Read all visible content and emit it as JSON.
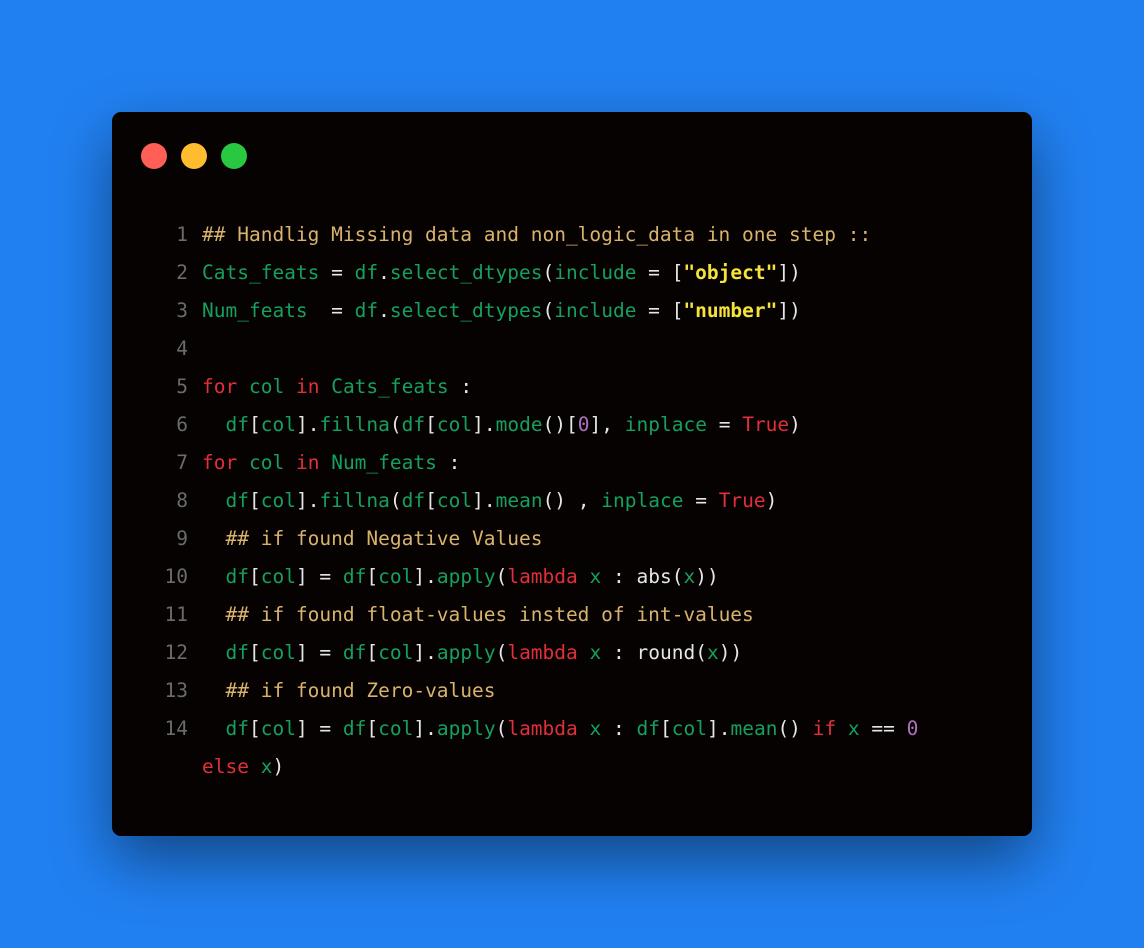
{
  "window": {
    "controls": [
      {
        "name": "close",
        "color": "#ff5f57"
      },
      {
        "name": "minimize",
        "color": "#febc2e"
      },
      {
        "name": "maximize",
        "color": "#28c840"
      }
    ]
  },
  "code": {
    "lines": [
      {
        "num": "1",
        "tokens": [
          {
            "t": "com",
            "v": "## Handlig Missing data and non_logic_data in one step ::"
          }
        ]
      },
      {
        "num": "2",
        "tokens": [
          {
            "t": "var",
            "v": "Cats_feats"
          },
          {
            "t": "pun",
            "v": " = "
          },
          {
            "t": "var",
            "v": "df"
          },
          {
            "t": "pun",
            "v": "."
          },
          {
            "t": "var",
            "v": "select_dtypes"
          },
          {
            "t": "pun",
            "v": "("
          },
          {
            "t": "var",
            "v": "include"
          },
          {
            "t": "pun",
            "v": " = ["
          },
          {
            "t": "str",
            "v": "\"object\""
          },
          {
            "t": "pun",
            "v": "])"
          }
        ]
      },
      {
        "num": "3",
        "tokens": [
          {
            "t": "var",
            "v": "Num_feats"
          },
          {
            "t": "pun",
            "v": "  = "
          },
          {
            "t": "var",
            "v": "df"
          },
          {
            "t": "pun",
            "v": "."
          },
          {
            "t": "var",
            "v": "select_dtypes"
          },
          {
            "t": "pun",
            "v": "("
          },
          {
            "t": "var",
            "v": "include"
          },
          {
            "t": "pun",
            "v": " = ["
          },
          {
            "t": "str",
            "v": "\"number\""
          },
          {
            "t": "pun",
            "v": "])"
          }
        ]
      },
      {
        "num": "4",
        "tokens": []
      },
      {
        "num": "5",
        "tokens": [
          {
            "t": "kw",
            "v": "for"
          },
          {
            "t": "pun",
            "v": " "
          },
          {
            "t": "var",
            "v": "col"
          },
          {
            "t": "pun",
            "v": " "
          },
          {
            "t": "kw",
            "v": "in"
          },
          {
            "t": "pun",
            "v": " "
          },
          {
            "t": "var",
            "v": "Cats_feats"
          },
          {
            "t": "pun",
            "v": " :"
          }
        ]
      },
      {
        "num": "6",
        "tokens": [
          {
            "t": "pun",
            "v": "  "
          },
          {
            "t": "var",
            "v": "df"
          },
          {
            "t": "pun",
            "v": "["
          },
          {
            "t": "var",
            "v": "col"
          },
          {
            "t": "pun",
            "v": "]."
          },
          {
            "t": "var",
            "v": "fillna"
          },
          {
            "t": "pun",
            "v": "("
          },
          {
            "t": "var",
            "v": "df"
          },
          {
            "t": "pun",
            "v": "["
          },
          {
            "t": "var",
            "v": "col"
          },
          {
            "t": "pun",
            "v": "]."
          },
          {
            "t": "var",
            "v": "mode"
          },
          {
            "t": "pun",
            "v": "()["
          },
          {
            "t": "num",
            "v": "0"
          },
          {
            "t": "pun",
            "v": "], "
          },
          {
            "t": "var",
            "v": "inplace"
          },
          {
            "t": "pun",
            "v": " = "
          },
          {
            "t": "kw",
            "v": "True"
          },
          {
            "t": "pun",
            "v": ")"
          }
        ]
      },
      {
        "num": "7",
        "tokens": [
          {
            "t": "kw",
            "v": "for"
          },
          {
            "t": "pun",
            "v": " "
          },
          {
            "t": "var",
            "v": "col"
          },
          {
            "t": "pun",
            "v": " "
          },
          {
            "t": "kw",
            "v": "in"
          },
          {
            "t": "pun",
            "v": " "
          },
          {
            "t": "var",
            "v": "Num_feats"
          },
          {
            "t": "pun",
            "v": " :"
          }
        ]
      },
      {
        "num": "8",
        "tokens": [
          {
            "t": "pun",
            "v": "  "
          },
          {
            "t": "var",
            "v": "df"
          },
          {
            "t": "pun",
            "v": "["
          },
          {
            "t": "var",
            "v": "col"
          },
          {
            "t": "pun",
            "v": "]."
          },
          {
            "t": "var",
            "v": "fillna"
          },
          {
            "t": "pun",
            "v": "("
          },
          {
            "t": "var",
            "v": "df"
          },
          {
            "t": "pun",
            "v": "["
          },
          {
            "t": "var",
            "v": "col"
          },
          {
            "t": "pun",
            "v": "]."
          },
          {
            "t": "var",
            "v": "mean"
          },
          {
            "t": "pun",
            "v": "() , "
          },
          {
            "t": "var",
            "v": "inplace"
          },
          {
            "t": "pun",
            "v": " = "
          },
          {
            "t": "kw",
            "v": "True"
          },
          {
            "t": "pun",
            "v": ")"
          }
        ]
      },
      {
        "num": "9",
        "tokens": [
          {
            "t": "com",
            "v": "  ## if found Negative Values"
          }
        ]
      },
      {
        "num": "10",
        "tokens": [
          {
            "t": "pun",
            "v": "  "
          },
          {
            "t": "var",
            "v": "df"
          },
          {
            "t": "pun",
            "v": "["
          },
          {
            "t": "var",
            "v": "col"
          },
          {
            "t": "pun",
            "v": "] = "
          },
          {
            "t": "var",
            "v": "df"
          },
          {
            "t": "pun",
            "v": "["
          },
          {
            "t": "var",
            "v": "col"
          },
          {
            "t": "pun",
            "v": "]."
          },
          {
            "t": "var",
            "v": "apply"
          },
          {
            "t": "pun",
            "v": "("
          },
          {
            "t": "kw",
            "v": "lambda"
          },
          {
            "t": "pun",
            "v": " "
          },
          {
            "t": "var",
            "v": "x"
          },
          {
            "t": "pun",
            "v": " : "
          },
          {
            "t": "fn",
            "v": "abs"
          },
          {
            "t": "pun",
            "v": "("
          },
          {
            "t": "var",
            "v": "x"
          },
          {
            "t": "pun",
            "v": "))"
          }
        ]
      },
      {
        "num": "11",
        "tokens": [
          {
            "t": "com",
            "v": "  ## if found float-values insted of int-values"
          }
        ]
      },
      {
        "num": "12",
        "tokens": [
          {
            "t": "pun",
            "v": "  "
          },
          {
            "t": "var",
            "v": "df"
          },
          {
            "t": "pun",
            "v": "["
          },
          {
            "t": "var",
            "v": "col"
          },
          {
            "t": "pun",
            "v": "] = "
          },
          {
            "t": "var",
            "v": "df"
          },
          {
            "t": "pun",
            "v": "["
          },
          {
            "t": "var",
            "v": "col"
          },
          {
            "t": "pun",
            "v": "]."
          },
          {
            "t": "var",
            "v": "apply"
          },
          {
            "t": "pun",
            "v": "("
          },
          {
            "t": "kw",
            "v": "lambda"
          },
          {
            "t": "pun",
            "v": " "
          },
          {
            "t": "var",
            "v": "x"
          },
          {
            "t": "pun",
            "v": " : "
          },
          {
            "t": "fn",
            "v": "round"
          },
          {
            "t": "pun",
            "v": "("
          },
          {
            "t": "var",
            "v": "x"
          },
          {
            "t": "pun",
            "v": "))"
          }
        ]
      },
      {
        "num": "13",
        "tokens": [
          {
            "t": "com",
            "v": "  ## if found Zero-values"
          }
        ]
      },
      {
        "num": "14",
        "wrap": true,
        "tokens": [
          {
            "t": "pun",
            "v": "  "
          },
          {
            "t": "var",
            "v": "df"
          },
          {
            "t": "pun",
            "v": "["
          },
          {
            "t": "var",
            "v": "col"
          },
          {
            "t": "pun",
            "v": "] = "
          },
          {
            "t": "var",
            "v": "df"
          },
          {
            "t": "pun",
            "v": "["
          },
          {
            "t": "var",
            "v": "col"
          },
          {
            "t": "pun",
            "v": "]."
          },
          {
            "t": "var",
            "v": "apply"
          },
          {
            "t": "pun",
            "v": "("
          },
          {
            "t": "kw",
            "v": "lambda"
          },
          {
            "t": "pun",
            "v": " "
          },
          {
            "t": "var",
            "v": "x"
          },
          {
            "t": "pun",
            "v": " : "
          },
          {
            "t": "var",
            "v": "df"
          },
          {
            "t": "pun",
            "v": "["
          },
          {
            "t": "var",
            "v": "col"
          },
          {
            "t": "pun",
            "v": "]."
          },
          {
            "t": "var",
            "v": "mean"
          },
          {
            "t": "pun",
            "v": "() "
          },
          {
            "t": "kw",
            "v": "if"
          },
          {
            "t": "pun",
            "v": " "
          },
          {
            "t": "var",
            "v": "x"
          },
          {
            "t": "pun",
            "v": " == "
          },
          {
            "t": "num",
            "v": "0"
          },
          {
            "t": "pun",
            "v": " "
          },
          {
            "t": "kw",
            "v": "else"
          },
          {
            "t": "pun",
            "v": " "
          },
          {
            "t": "var",
            "v": "x"
          },
          {
            "t": "pun",
            "v": ")"
          }
        ]
      }
    ]
  }
}
